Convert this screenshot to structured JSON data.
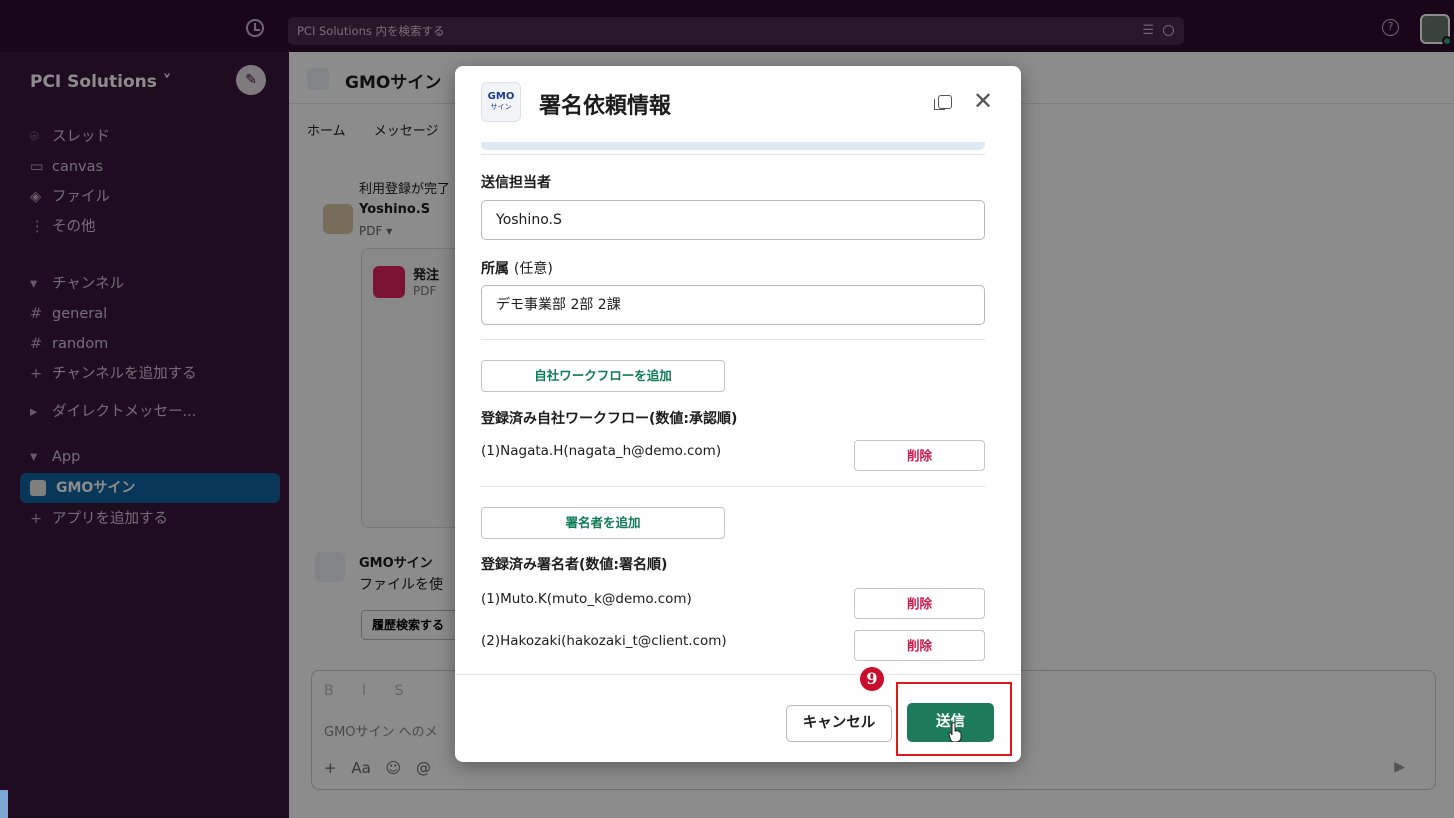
{
  "topbar": {
    "search_placeholder": "PCI Solutions 内を検索する",
    "filter_glyph": "☰",
    "help_glyph": "?"
  },
  "sidebar": {
    "workspace": "PCI Solutions",
    "items": [
      {
        "icon": "thread-icon",
        "glyph": "⌾",
        "label": "スレッド"
      },
      {
        "icon": "canvas-icon",
        "glyph": "▭",
        "label": "canvas"
      },
      {
        "icon": "files-icon",
        "glyph": "◈",
        "label": "ファイル"
      },
      {
        "icon": "more-icon",
        "glyph": "⋮",
        "label": "その他"
      }
    ],
    "channels_header": "チャンネル",
    "channels": [
      {
        "label": "general"
      },
      {
        "label": "random"
      }
    ],
    "add_channel": "チャンネルを追加する",
    "dm_header": "ダイレクトメッセー...",
    "app_header": "App",
    "active_app": "GMOサイン",
    "add_app": "アプリを追加する"
  },
  "channel": {
    "title": "GMOサイン",
    "tabs": [
      "ホーム",
      "メッセージ"
    ],
    "line1": "利用登録が完了",
    "user": "Yoshino.S",
    "pdf_label": "PDF ▾",
    "file_title": "発注",
    "file_type": "PDF",
    "bot_name": "GMOサイン",
    "bot_text": "ファイルを使",
    "history_button": "履歴検索する",
    "composer_placeholder": "GMOサイン へのメ",
    "composer_format": "B I S",
    "composer_tools": "+ Aa ☺ @",
    "composer_send": "▶"
  },
  "modal": {
    "title": "署名依頼情報",
    "logo_line1": "GMO",
    "logo_line2": "サイン",
    "sender_label": "送信担当者",
    "sender_value": "Yoshino.S",
    "affiliation_label": "所属",
    "affiliation_optional": "(任意)",
    "affiliation_value": "デモ事業部 2部 2課",
    "add_workflow_button": "自社ワークフローを追加",
    "workflows_label": "登録済み自社ワークフロー(数値:承認順)",
    "workflows": [
      {
        "text": "(1)Nagata.H(nagata_h@demo.com)",
        "delete": "削除"
      }
    ],
    "add_signer_button": "署名者を追加",
    "signers_label": "登録済み署名者(数値:署名順)",
    "signers": [
      {
        "text": "(1)Muto.K(muto_k@demo.com)",
        "delete": "削除"
      },
      {
        "text": "(2)Hakozaki(hakozaki_t@client.com)",
        "delete": "削除"
      }
    ],
    "cancel_button": "キャンセル",
    "send_button": "送信"
  },
  "annotation": {
    "step_number": "9"
  },
  "colors": {
    "accent_green": "#1d7a5a",
    "delete_red": "#c61a4c",
    "highlight_red": "#e01818",
    "sidebar_bg": "#3a163c"
  }
}
